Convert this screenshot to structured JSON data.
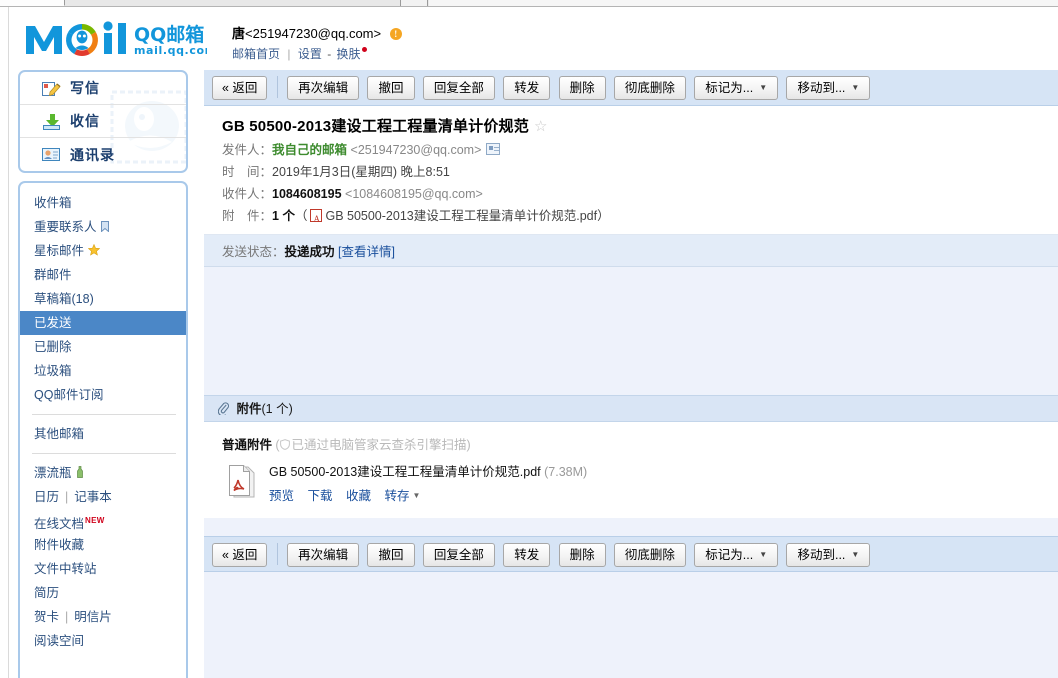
{
  "brand": {
    "logo_text": "Mail",
    "logo_cn": "QQ邮箱",
    "logo_domain": "mail.qq.com",
    "accent_blue": "#1296db",
    "accent_green": "#7ab800",
    "accent_orange": "#f07f13",
    "accent_red": "#e23b2e"
  },
  "header": {
    "account_name": "唐",
    "account_address": "<251947230@qq.com>",
    "warning_glyph": "!",
    "links": {
      "home": "邮箱首页",
      "settings": "设置",
      "skin": "换肤"
    },
    "separator": "|",
    "dash": "-"
  },
  "sidebar": {
    "compose": [
      {
        "label": "写信",
        "icon": "compose-icon"
      },
      {
        "label": "收信",
        "icon": "receive-icon"
      },
      {
        "label": "通讯录",
        "icon": "contacts-icon"
      }
    ],
    "folders": [
      {
        "label": "收件箱",
        "selected": false,
        "badge": ""
      },
      {
        "label": "重要联系人",
        "selected": false,
        "badge": "bookmark"
      },
      {
        "label": "星标邮件",
        "selected": false,
        "badge": "star"
      },
      {
        "label": "群邮件",
        "selected": false,
        "badge": ""
      },
      {
        "label": "草稿箱(18)",
        "selected": false,
        "badge": ""
      },
      {
        "label": "已发送",
        "selected": true,
        "badge": ""
      },
      {
        "label": "已删除",
        "selected": false,
        "badge": ""
      },
      {
        "label": "垃圾箱",
        "selected": false,
        "badge": ""
      },
      {
        "label": "QQ邮件订阅",
        "selected": false,
        "badge": ""
      }
    ],
    "other_mailbox": "其他邮箱",
    "tools": [
      {
        "label": "漂流瓶",
        "badge": "bottle",
        "new": false
      },
      {
        "label": "日历",
        "label2": "记事本",
        "badge": "",
        "new": false
      },
      {
        "label": "在线文档",
        "badge": "",
        "new": true,
        "new_text": "NEW"
      },
      {
        "label": "附件收藏",
        "badge": "",
        "new": false
      },
      {
        "label": "文件中转站",
        "badge": "",
        "new": false
      },
      {
        "label": "简历",
        "badge": "",
        "new": false
      },
      {
        "label": "贺卡",
        "label2": "明信片",
        "badge": "",
        "new": false
      },
      {
        "label": "阅读空间",
        "badge": "",
        "new": false
      }
    ],
    "pipe": "|"
  },
  "toolbar": {
    "back": "« 返回",
    "buttons": [
      {
        "label": "再次编辑",
        "dropdown": false
      },
      {
        "label": "撤回",
        "dropdown": false
      },
      {
        "label": "回复全部",
        "dropdown": false
      },
      {
        "label": "转发",
        "dropdown": false
      },
      {
        "label": "删除",
        "dropdown": false
      },
      {
        "label": "彻底删除",
        "dropdown": false
      },
      {
        "label": "标记为...",
        "dropdown": true
      },
      {
        "label": "移动到...",
        "dropdown": true
      }
    ],
    "caret": "▼"
  },
  "mail": {
    "subject": "GB 50500-2013建设工程工程量清单计价规范",
    "star_glyph": "☆",
    "from_label": "发件人：",
    "from_name": "我自己的邮箱",
    "from_address": "<251947230@qq.com>",
    "time_label": "时　间：",
    "time_value": "2019年1月3日(星期四) 晚上8:51",
    "to_label": "收件人：",
    "to_name": "1084608195",
    "to_address": "<1084608195@qq.com>",
    "att_label": "附　件：",
    "att_count": "1 个",
    "att_open": "（",
    "att_filename": "GB 50500-2013建设工程工程量清单计价规范.pdf",
    "att_close": "）",
    "status_label": "发送状态：",
    "status_value": "投递成功",
    "status_detail": "[查看详情]"
  },
  "attachment": {
    "header": "附件",
    "header_count": "(1 个)",
    "type_label": "普通附件",
    "scan_open": "(",
    "scan_text": "已通过电脑管家云查杀引擎扫描",
    "scan_close": ")",
    "file_name": "GB 50500-2013建设工程工程量清单计价规范.pdf",
    "file_size": "(7.38M)",
    "actions": [
      {
        "label": "预览",
        "dropdown": false
      },
      {
        "label": "下载",
        "dropdown": false
      },
      {
        "label": "收藏",
        "dropdown": false
      },
      {
        "label": "转存",
        "dropdown": true
      }
    ],
    "caret": "▼"
  }
}
